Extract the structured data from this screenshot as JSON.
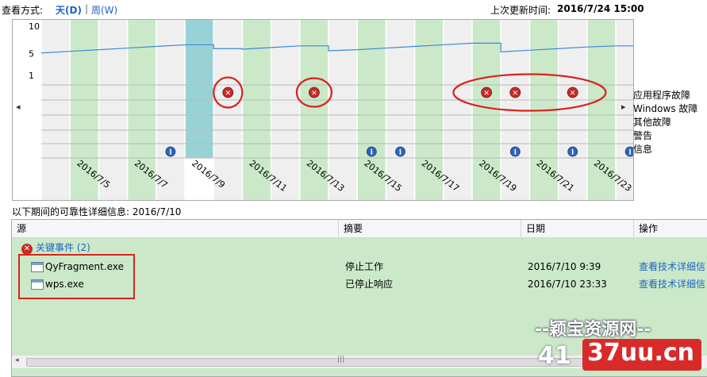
{
  "toolbar": {
    "view_label": "查看方式:",
    "view_day": "天(D)",
    "separator": "|",
    "view_week": "周(W)",
    "last_update_label": "上次更新时间:",
    "last_update_value": "2016/7/24 15:00"
  },
  "chart": {
    "y_ticks": [
      "10",
      "5",
      "1"
    ],
    "categories": [
      "应用程序故障",
      "Windows 故障",
      "其他故障",
      "警告",
      "信息"
    ],
    "date_labels": [
      "2016/7/5",
      "2016/7/7",
      "2016/7/9",
      "2016/7/11",
      "2016/7/13",
      "2016/7/15",
      "2016/7/17",
      "2016/7/19",
      "2016/7/21",
      "2016/7/23"
    ],
    "nav_left": "◂",
    "nav_right": "▸",
    "selected_date": "2016/7/9",
    "colors": {
      "grid_green": "#cbe9c9",
      "grid_gray": "#efefef",
      "selected": "#99d2d6",
      "line": "#3a8ad7",
      "annotation": "#d8241c"
    }
  },
  "chart_data": {
    "type": "line",
    "dates": [
      "2016/7/4",
      "2016/7/5",
      "2016/7/6",
      "2016/7/7",
      "2016/7/8",
      "2016/7/9",
      "2016/7/10",
      "2016/7/11",
      "2016/7/12",
      "2016/7/13",
      "2016/7/14",
      "2016/7/15",
      "2016/7/16",
      "2016/7/17",
      "2016/7/18",
      "2016/7/19",
      "2016/7/20",
      "2016/7/21",
      "2016/7/22",
      "2016/7/23",
      "2016/7/24"
    ],
    "stability_index": [
      5.1,
      5.4,
      5.7,
      6.0,
      6.3,
      6.6,
      5.9,
      5.8,
      6.1,
      6.4,
      5.5,
      5.7,
      6.0,
      6.3,
      6.6,
      6.9,
      5.3,
      5.6,
      5.9,
      6.2,
      6.4
    ],
    "ylim": [
      0,
      10
    ],
    "y_ticks": [
      1,
      5,
      10
    ],
    "application_failures": [
      "2016/7/10",
      "2016/7/13",
      "2016/7/19",
      "2016/7/20",
      "2016/7/22"
    ],
    "information_events": [
      "2016/7/8",
      "2016/7/15",
      "2016/7/16",
      "2016/7/20",
      "2016/7/22",
      "2016/7/24"
    ]
  },
  "details": {
    "title": "以下期间的可靠性详细信息: 2016/7/10",
    "columns": [
      "源",
      "摘要",
      "日期",
      "操作"
    ],
    "group_label": "关键事件 (2)",
    "rows": [
      {
        "source": "QyFragment.exe",
        "summary": "停止工作",
        "date": "2016/7/10 9:39",
        "action": "查看技术详细信"
      },
      {
        "source": "wps.exe",
        "summary": "已停止响应",
        "date": "2016/7/10 23:33",
        "action": "查看技术详细信"
      }
    ]
  },
  "watermark": {
    "line1": "--颖宝资源网--",
    "number": "41",
    "domain": "37uu.cn"
  }
}
